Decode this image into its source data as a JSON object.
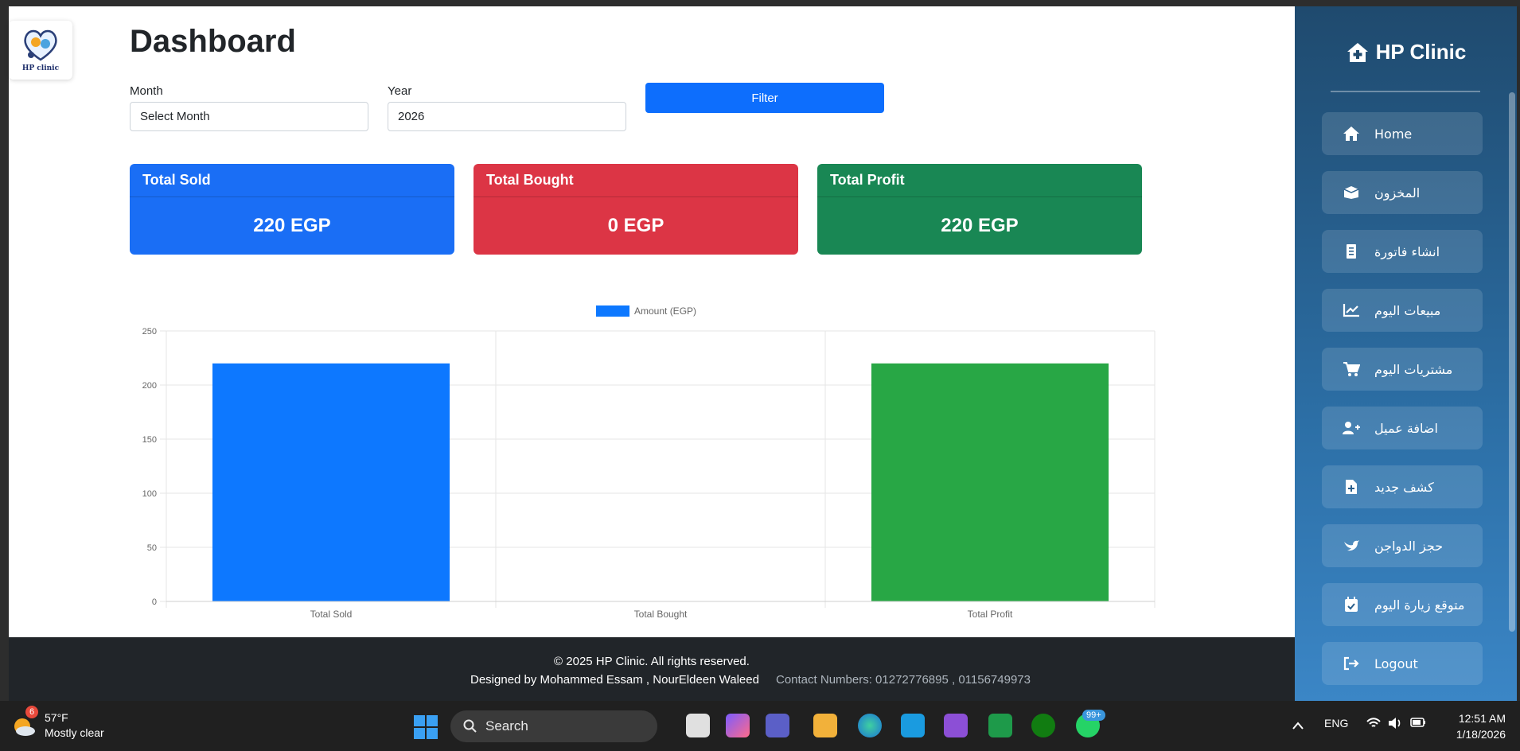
{
  "page": {
    "title": "Dashboard",
    "logo_text": "HP clinic"
  },
  "filters": {
    "month_label": "Month",
    "month_value": "Select Month",
    "year_label": "Year",
    "year_value": "2026",
    "filter_button": "Filter"
  },
  "cards": [
    {
      "title": "Total Sold",
      "value": "220 EGP",
      "color": "#1a6ef5"
    },
    {
      "title": "Total Bought",
      "value": "0 EGP",
      "color": "#dc3545"
    },
    {
      "title": "Total Profit",
      "value": "220 EGP",
      "color": "#198754"
    }
  ],
  "chart_data": {
    "type": "bar",
    "categories": [
      "Total Sold",
      "Total Bought",
      "Total Profit"
    ],
    "series": [
      {
        "name": "Amount (EGP)",
        "values": [
          220,
          0,
          220
        ]
      }
    ],
    "colors": [
      "#0d78ff",
      "#dc3545",
      "#28a745"
    ],
    "ylim": [
      0,
      250
    ],
    "yticks": [
      0,
      50,
      100,
      150,
      200,
      250
    ],
    "grid": true,
    "legend": "top-center"
  },
  "footer": {
    "copyright": "© 2025 HP Clinic. All rights reserved.",
    "designers": "Designed by Mohammed Essam , NourEldeen Waleed",
    "contacts": "Contact Numbers: 01272776895 , 01156749973"
  },
  "sidebar": {
    "brand": "HP Clinic",
    "items": [
      {
        "label": "Home",
        "icon": "home-icon"
      },
      {
        "label": "المخزون",
        "icon": "box-icon"
      },
      {
        "label": "انشاء فاتورة",
        "icon": "receipt-icon"
      },
      {
        "label": "مبيعات اليوم",
        "icon": "chart-line-icon"
      },
      {
        "label": "مشتريات اليوم",
        "icon": "cart-icon"
      },
      {
        "label": "اضافة عميل",
        "icon": "user-plus-icon"
      },
      {
        "label": "كشف جديد",
        "icon": "file-plus-icon"
      },
      {
        "label": "حجز الدواجن",
        "icon": "bird-icon"
      },
      {
        "label": "متوقع زيارة اليوم",
        "icon": "calendar-check-icon"
      },
      {
        "label": "Logout",
        "icon": "logout-icon"
      }
    ]
  },
  "taskbar": {
    "weather_badge": "6",
    "temperature": "57°F",
    "weather": "Mostly clear",
    "search": "Search",
    "notification_badge": "99+",
    "language": "ENG",
    "time": "12:51 AM",
    "date": "1/18/2026"
  }
}
